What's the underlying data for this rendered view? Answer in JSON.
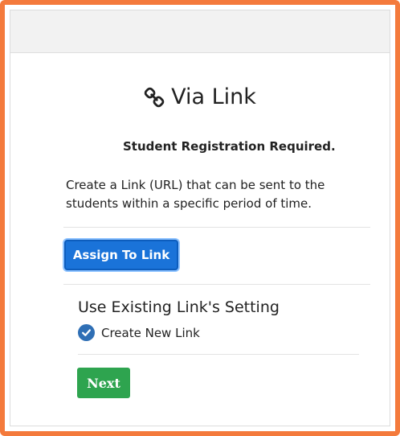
{
  "header": {
    "title": "Via Link",
    "title_icon": "link-icon"
  },
  "intro": {
    "subtitle": "Student Registration Required.",
    "description": "Create a Link (URL) that can be sent to the students within a specific period of time."
  },
  "actions": {
    "assign_label": "Assign To Link"
  },
  "existing": {
    "section_title": "Use Existing Link's Setting",
    "option_label": "Create New Link",
    "option_checked": true
  },
  "footer": {
    "next_label": "Next"
  },
  "colors": {
    "frame_border": "#f47a3c",
    "primary": "#1a73d9",
    "success": "#2ea44f",
    "check": "#2f6fb5"
  }
}
